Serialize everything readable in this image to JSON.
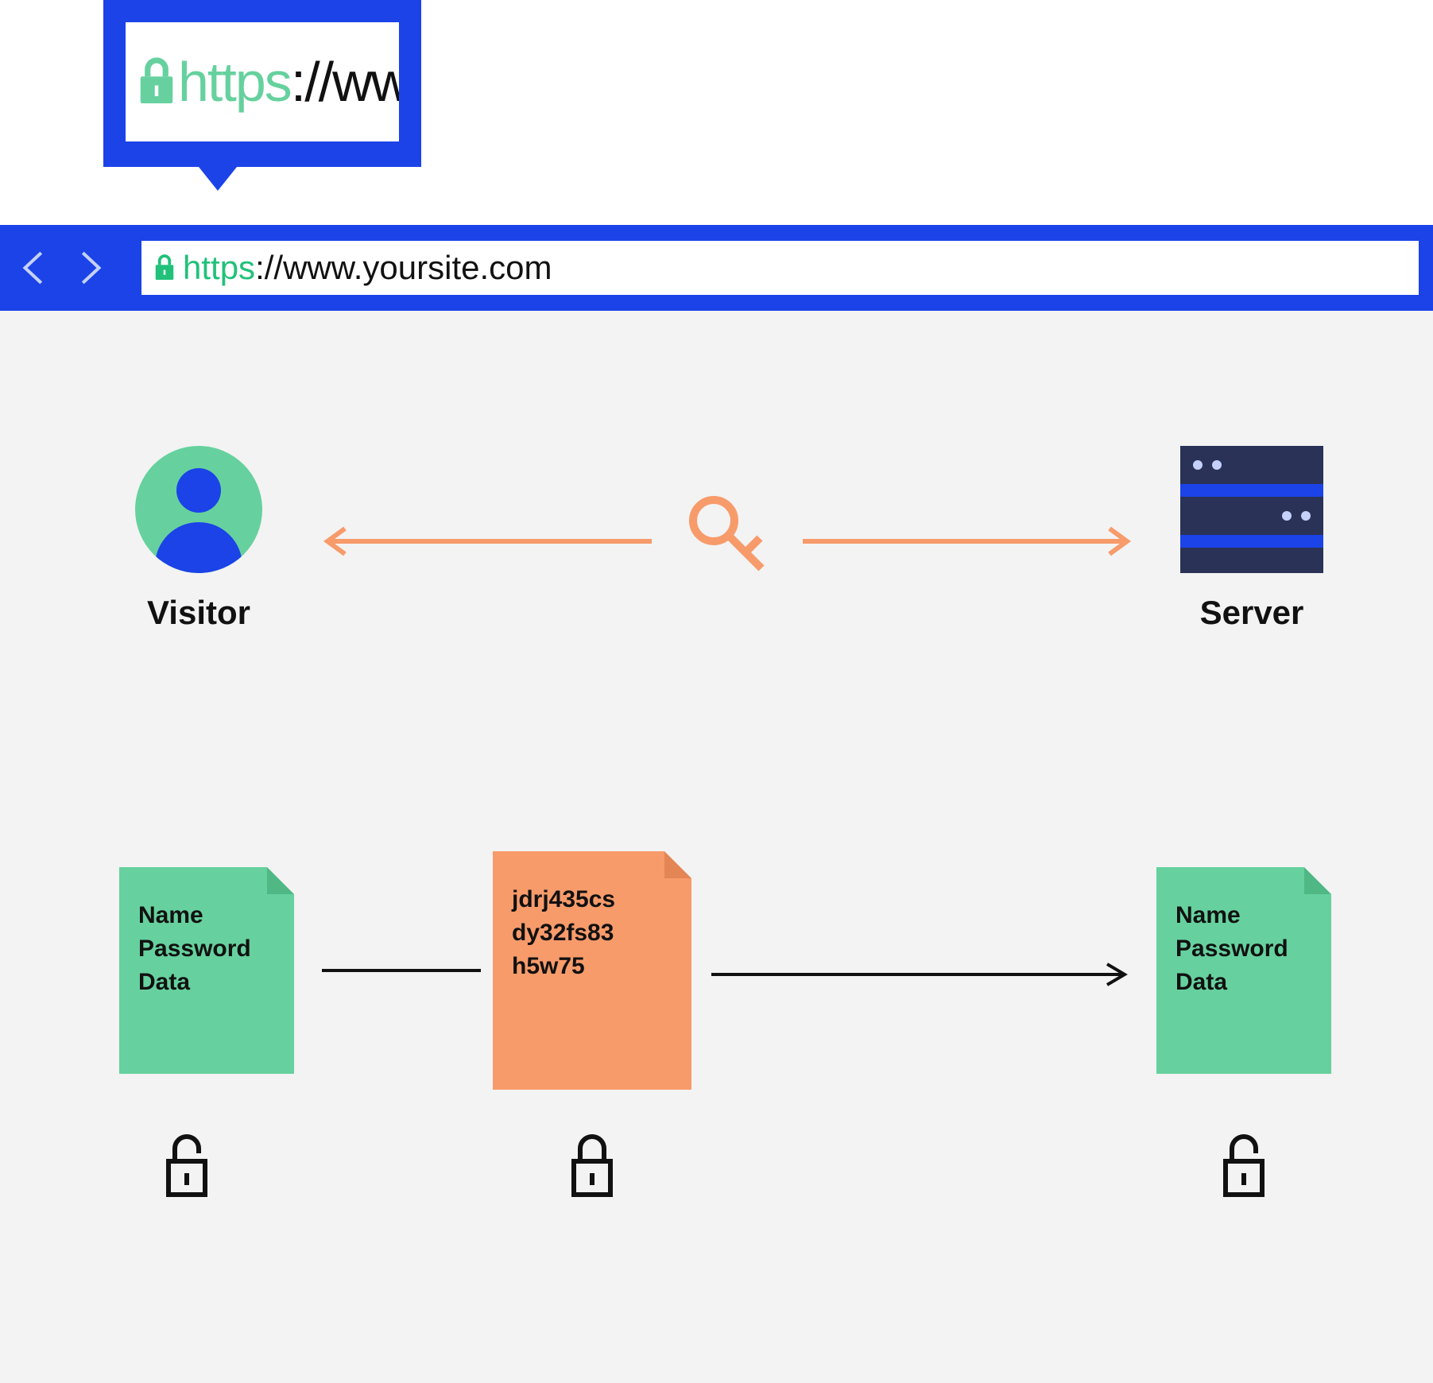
{
  "callout": {
    "https": "https",
    "rest": "://ww"
  },
  "address_bar": {
    "https": "https",
    "rest": "://www.yoursite.com"
  },
  "actors": {
    "visitor_label": "Visitor",
    "server_label": "Server"
  },
  "documents": {
    "plain": {
      "line1": "Name",
      "line2": "Password",
      "line3": "Data"
    },
    "encrypted": {
      "line1": "jdrj435cs",
      "line2": "dy32fs83",
      "line3": "h5w75"
    },
    "decrypted": {
      "line1": "Name",
      "line2": "Password",
      "line3": "Data"
    }
  },
  "colors": {
    "brand_blue": "#1b43e8",
    "green": "#66d19e",
    "orange": "#f79b6b",
    "panel": "#f3f3f3",
    "dark_navy": "#2a3258"
  }
}
